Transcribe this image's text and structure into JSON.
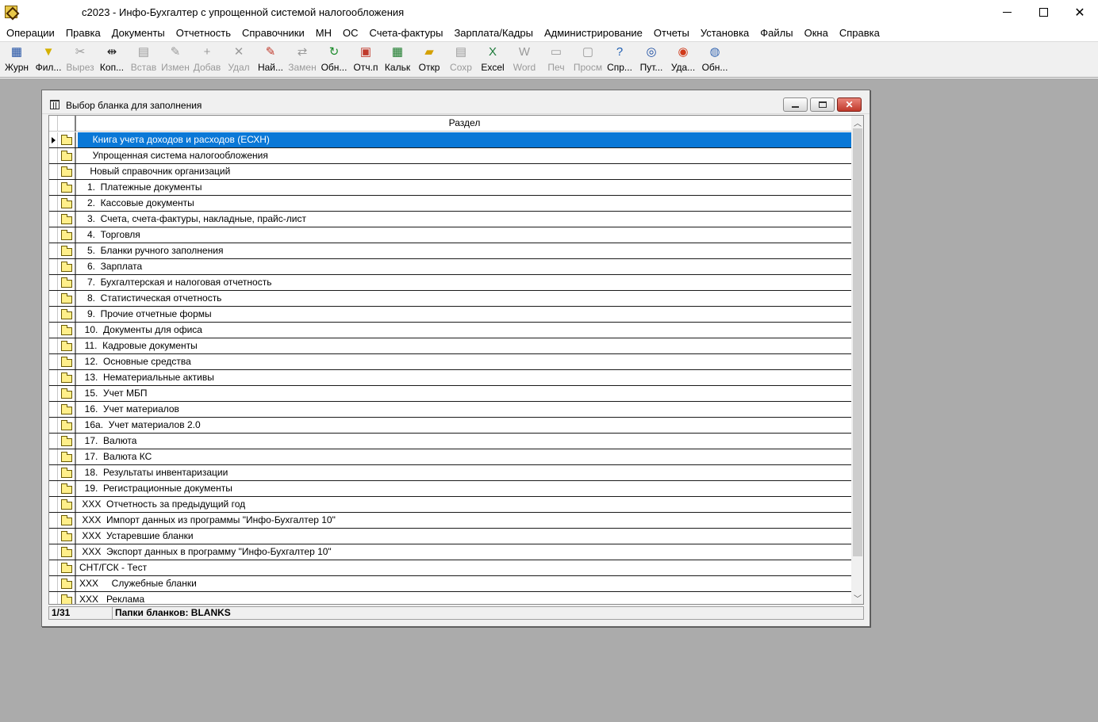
{
  "window": {
    "title": "с2023 - Инфо-Бухгалтер с упрощенной системой налогообложения",
    "icon": "app-icon"
  },
  "menu": [
    "Операции",
    "Правка",
    "Документы",
    "Отчетность",
    "Справочники",
    "МН",
    "ОС",
    "Счета-фактуры",
    "Зарплата/Кадры",
    "Администрирование",
    "Отчеты",
    "Установка",
    "Файлы",
    "Окна",
    "Справка"
  ],
  "toolbar": [
    {
      "label": "Журн",
      "icon": "journal-icon",
      "glyph": "▦",
      "color": "#1f4fa3",
      "enabled": true
    },
    {
      "label": "Фил...",
      "icon": "filter-icon",
      "glyph": "▼",
      "color": "#d4b000",
      "enabled": true
    },
    {
      "label": "Вырез",
      "icon": "cut-icon",
      "glyph": "✂",
      "color": "#9a9a9a",
      "enabled": false
    },
    {
      "label": "Коп...",
      "icon": "copy-icon",
      "glyph": "⇹",
      "color": "#222222",
      "enabled": true
    },
    {
      "label": "Встав",
      "icon": "paste-icon",
      "glyph": "▤",
      "color": "#9a9a9a",
      "enabled": false
    },
    {
      "label": "Измен",
      "icon": "edit-icon",
      "glyph": "✎",
      "color": "#9a9a9a",
      "enabled": false
    },
    {
      "label": "Добав",
      "icon": "add-icon",
      "glyph": "+",
      "color": "#9a9a9a",
      "enabled": false
    },
    {
      "label": "Удал",
      "icon": "delete-icon",
      "glyph": "✕",
      "color": "#9a9a9a",
      "enabled": false
    },
    {
      "label": "Най...",
      "icon": "find-icon",
      "glyph": "✎",
      "color": "#c0392b",
      "enabled": true
    },
    {
      "label": "Замен",
      "icon": "replace-icon",
      "glyph": "⇄",
      "color": "#9a9a9a",
      "enabled": false
    },
    {
      "label": "Обн...",
      "icon": "refresh-icon",
      "glyph": "↻",
      "color": "#1a8a2a",
      "enabled": true
    },
    {
      "label": "Отч.п",
      "icon": "report-icon",
      "glyph": "▣",
      "color": "#c0392b",
      "enabled": true
    },
    {
      "label": "Кальк",
      "icon": "calculator-icon",
      "glyph": "▦",
      "color": "#1a7a2a",
      "enabled": true
    },
    {
      "label": "Откр",
      "icon": "open-folder-icon",
      "glyph": "▰",
      "color": "#d4a000",
      "enabled": true
    },
    {
      "label": "Сохр",
      "icon": "save-icon",
      "glyph": "▤",
      "color": "#9a9a9a",
      "enabled": false
    },
    {
      "label": "Excel",
      "icon": "excel-icon",
      "glyph": "X",
      "color": "#1d7a3a",
      "enabled": true
    },
    {
      "label": "Word",
      "icon": "word-icon",
      "glyph": "W",
      "color": "#9a9a9a",
      "enabled": false
    },
    {
      "label": "Печ",
      "icon": "print-icon",
      "glyph": "▭",
      "color": "#9a9a9a",
      "enabled": false
    },
    {
      "label": "Просм",
      "icon": "preview-icon",
      "glyph": "▢",
      "color": "#9a9a9a",
      "enabled": false
    },
    {
      "label": "Спр...",
      "icon": "help-icon",
      "glyph": "?",
      "color": "#1f5fb3",
      "enabled": true
    },
    {
      "label": "Пут...",
      "icon": "compass-icon",
      "glyph": "◎",
      "color": "#1f4fa3",
      "enabled": true
    },
    {
      "label": "Уда...",
      "icon": "lifebuoy-icon",
      "glyph": "◉",
      "color": "#d03a1a",
      "enabled": true
    },
    {
      "label": "Обн...",
      "icon": "globe-update-icon",
      "glyph": "◍",
      "color": "#3a6ab3",
      "enabled": true
    }
  ],
  "dialog": {
    "title": "Выбор бланка для заполнения",
    "column_header": "Раздел",
    "rows": [
      "     Книга учета доходов и расходов (ЕСХН)",
      "     Упрощенная система налогообложения",
      "    Новый справочник организаций",
      "   1.  Платежные документы",
      "   2.  Кассовые документы",
      "   3.  Счета, счета-фактуры, накладные, прайс-лист",
      "   4.  Торговля",
      "   5.  Бланки ручного заполнения",
      "   6.  Зарплата",
      "   7.  Бухгалтерская и налоговая отчетность",
      "   8.  Статистическая отчетность",
      "   9.  Прочие отчетные формы",
      "  10.  Документы для офиса",
      "  11.  Кадровые документы",
      "  12.  Основные средства",
      "  13.  Нематериальные активы",
      "  15.  Учет МБП",
      "  16.  Учет материалов",
      "  16а.  Учет материалов 2.0",
      "  17.  Валюта",
      "  17.  Валюта КС",
      "  18.  Результаты инвентаризации",
      "  19.  Регистрационные документы",
      " XXX  Отчетность за предыдущий год",
      " XXX  Импорт данных из программы \"Инфо-Бухгалтер 10\"",
      " XXX  Устаревшие бланки",
      " XXX  Экспорт данных в программу \"Инфо-Бухгалтер 10\"",
      "СНТ/ГСК - Тест",
      "XXX     Служебные бланки",
      "XXX   Реклама"
    ],
    "selected_index": 0,
    "status_position": "1/31",
    "status_folder": "Папки бланков: BLANKS"
  }
}
